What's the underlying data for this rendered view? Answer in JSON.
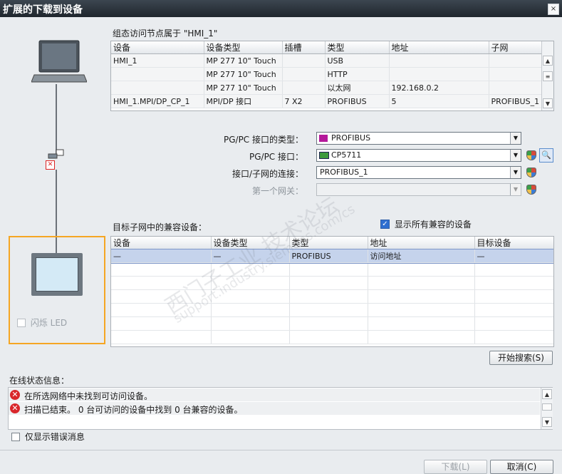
{
  "window": {
    "title": "扩展的下载到设备",
    "close_glyph": "×"
  },
  "config_section": {
    "label": "组态访问节点属于 \"HMI_1\"",
    "columns": [
      "设备",
      "设备类型",
      "插槽",
      "类型",
      "地址",
      "子网"
    ],
    "rows": [
      [
        "HMI_1",
        "MP 277 10\" Touch",
        "",
        "USB",
        "",
        ""
      ],
      [
        "",
        "MP 277 10\" Touch",
        "",
        "HTTP",
        "",
        ""
      ],
      [
        "",
        "MP 277 10\" Touch",
        "",
        "以太网",
        "192.168.0.2",
        ""
      ],
      [
        "HMI_1.MPI/DP_CP_1",
        "MPI/DP 接口",
        "7 X2",
        "PROFIBUS",
        "5",
        "PROFIBUS_1"
      ]
    ]
  },
  "pgpc": {
    "type_label": "PG/PC 接口的类型：",
    "type_value": "PROFIBUS",
    "iface_label": "PG/PC 接口：",
    "iface_value": "CP5711",
    "conn_label": "接口/子网的连接：",
    "conn_value": "PROFIBUS_1",
    "gateway_label": "第一个网关：",
    "gateway_value": ""
  },
  "target_section": {
    "label": "目标子网中的兼容设备：",
    "show_all_label": "显示所有兼容的设备",
    "show_all_checked": true,
    "columns": [
      "设备",
      "设备类型",
      "类型",
      "地址",
      "目标设备"
    ],
    "rows": [
      [
        "—",
        "—",
        "PROFIBUS",
        "访问地址",
        "—"
      ]
    ],
    "search_button": "开始搜索(S)"
  },
  "left_panel": {
    "flash_led_label": "闪烁 LED"
  },
  "status": {
    "label": "在线状态信息：",
    "messages": [
      "在所选网络中未找到可访问设备。",
      "扫描已结束。 0 台可访问的设备中找到 0 台兼容的设备。"
    ],
    "only_errors_label": "仅显示错误消息"
  },
  "footer": {
    "download_button": "下载(L)",
    "cancel_button": "取消(C)"
  },
  "watermark": {
    "line1": "西门子工业 技术论坛",
    "line2": "support.industry.siemens.com/cs"
  },
  "colors": {
    "accent_orange": "#f5a623",
    "selected_row": "#c5d3ec",
    "titlebar": "#2a323a"
  }
}
